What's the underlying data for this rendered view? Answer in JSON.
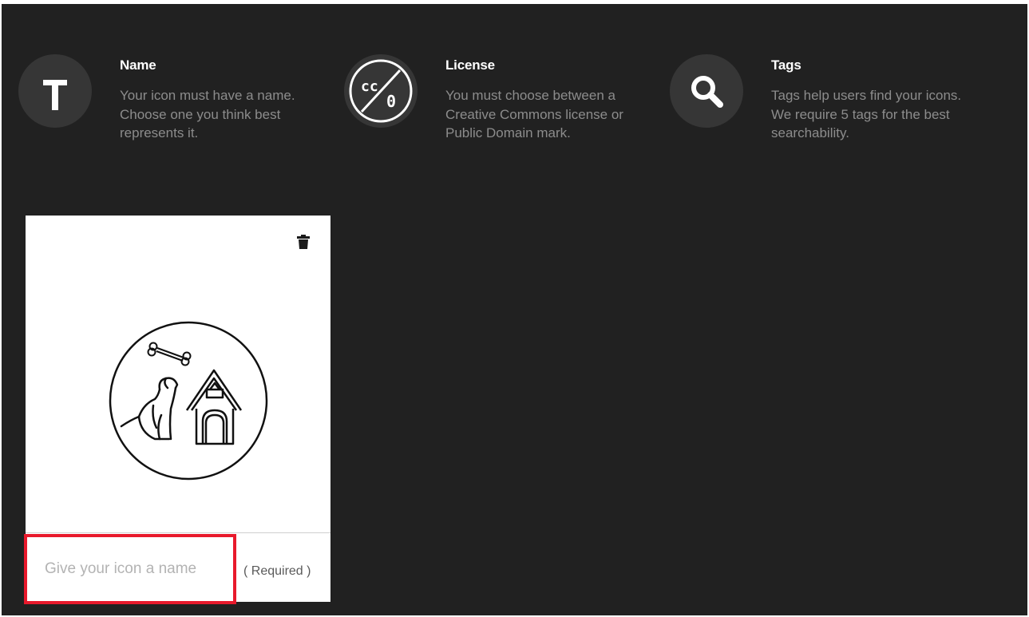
{
  "info": [
    {
      "icon": "text-t-icon",
      "title": "Name",
      "description": "Your icon must have a name. Choose one you think best represents it."
    },
    {
      "icon": "cc-zero-icon",
      "title": "License",
      "description": "You must choose between a Creative Commons license or Public Domain mark."
    },
    {
      "icon": "search-icon",
      "title": "Tags",
      "description": "Tags help users find your icons. We require 5 tags for the best searchability."
    }
  ],
  "card": {
    "delete_icon": "trash-icon",
    "preview_icon": "dog-and-doghouse-icon",
    "name_input": {
      "value": "",
      "placeholder": "Give your icon a name"
    },
    "required_label": "( Required )"
  },
  "colors": {
    "background": "#212121",
    "icon_circle": "#363636",
    "title_text": "#ffffff",
    "description_text": "#8c8c8c",
    "highlight_border": "#e8192c"
  }
}
